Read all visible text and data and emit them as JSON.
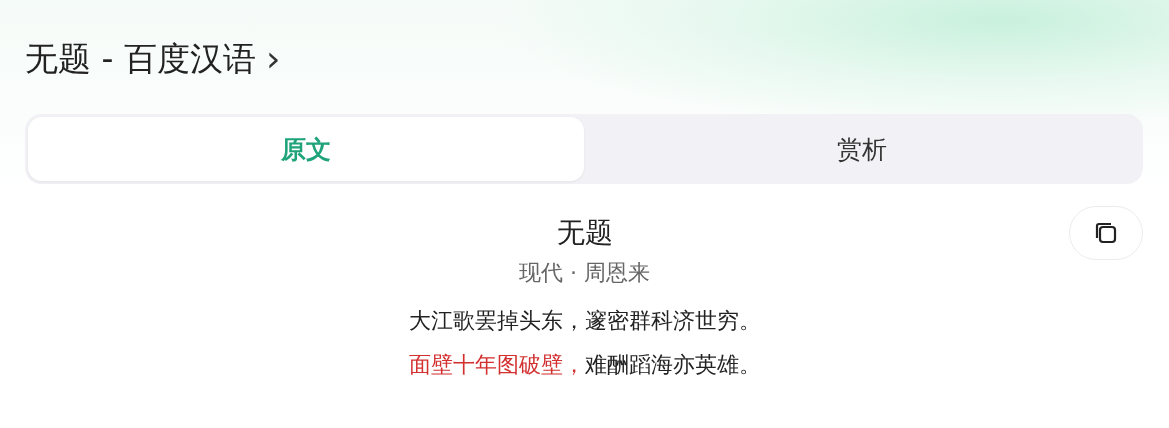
{
  "header": {
    "title": "无题 - 百度汉语",
    "chevron": "›"
  },
  "tabs": [
    {
      "label": "原文",
      "selected": true
    },
    {
      "label": "赏析",
      "selected": false
    }
  ],
  "poem": {
    "title": "无题",
    "meta": "现代 · 周恩来",
    "lines": [
      {
        "parts": [
          {
            "text": "大江歌罢掉头东，邃密群科济世穷。",
            "highlighted": false
          }
        ]
      },
      {
        "parts": [
          {
            "text": "面壁十年图破壁，",
            "highlighted": true
          },
          {
            "text": "难酬蹈海亦英雄。",
            "highlighted": false
          }
        ]
      }
    ]
  }
}
